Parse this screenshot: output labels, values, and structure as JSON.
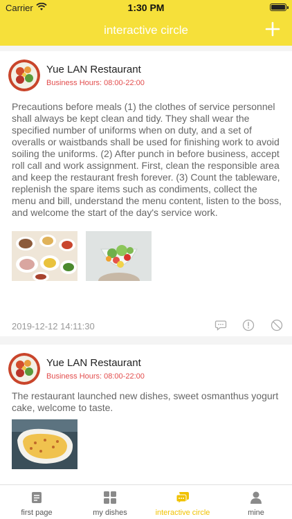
{
  "status_bar": {
    "carrier": "Carrier",
    "time": "1:30 PM"
  },
  "nav": {
    "title": "interactive circle",
    "add_icon": "plus-icon"
  },
  "posts": [
    {
      "name": "Yue LAN Restaurant",
      "hours": "Business Hours: 08:00-22:00",
      "text": "Precautions before meals (1) the clothes of service personnel shall always be kept clean and tidy. They shall wear the specified number of uniforms when on duty, and a set of overalls or waistbands shall be used for finishing work to avoid soiling the uniforms. (2) After punch in before business, accept roll call and work assignment. First, clean the responsible area and keep the restaurant fresh forever. (3) Count the tableware, replenish the spare items such as condiments, collect the menu and bill, understand the menu content, listen to the boss, and welcome the start of the day's service work.",
      "date": "2019-12-12 14:11:30"
    },
    {
      "name": "Yue LAN Restaurant",
      "hours": "Business Hours: 08:00-22:00",
      "text": "The restaurant launched new dishes, sweet osmanthus yogurt cake, welcome to taste."
    }
  ],
  "tabs": [
    {
      "label": "first page",
      "icon": "document-icon"
    },
    {
      "label": "my dishes",
      "icon": "grid-icon"
    },
    {
      "label": "interactive circle",
      "icon": "chat-icon"
    },
    {
      "label": "mine",
      "icon": "user-icon"
    }
  ],
  "colors": {
    "accent": "#f6e03a",
    "active_tab": "#f0c200",
    "hours": "#e24c4c"
  }
}
